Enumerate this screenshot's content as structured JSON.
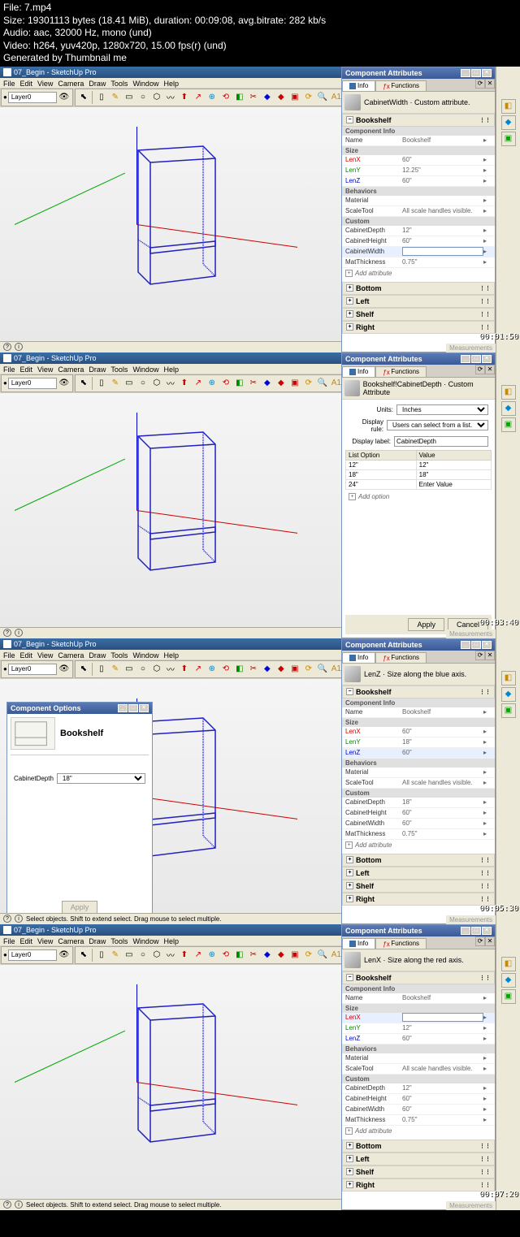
{
  "file_info": {
    "line1": "File: 7.mp4",
    "line2": "Size: 19301113 bytes (18.41 MiB), duration: 00:09:08, avg.bitrate: 282 kb/s",
    "line3": "Audio: aac, 32000 Hz, mono (und)",
    "line4": "Video: h264, yuv420p, 1280x720, 15.00 fps(r) (und)",
    "line5": "Generated by Thumbnail me"
  },
  "app_title": "07_Begin - SketchUp Pro",
  "menus": [
    "File",
    "Edit",
    "View",
    "Camera",
    "Draw",
    "Tools",
    "Window",
    "Help"
  ],
  "layer": "Layer0",
  "panel_title": "Component Attributes",
  "tabs": {
    "info": "Info",
    "functions": "Functions"
  },
  "frame1": {
    "header_text": "CabinetWidth · Custom attribute.",
    "bookshelf": "Bookshelf",
    "comp_info": "Component Info",
    "name_label": "Name",
    "name_val": "Bookshelf",
    "size": "Size",
    "lenx": "LenX",
    "lenx_val": "60\"",
    "leny": "LenY",
    "leny_val": "12.25\"",
    "lenz": "LenZ",
    "lenz_val": "60\"",
    "behaviors": "Behaviors",
    "material": "Material",
    "scaletool": "ScaleTool",
    "scaletool_val": "All scale handles visible.",
    "custom": "Custom",
    "cdepth": "CabinetDepth",
    "cdepth_val": "12\"",
    "cheight": "CabinetHeight",
    "cheight_val": "60\"",
    "cwidth": "CabinetWidth",
    "cwidth_val": "",
    "mthick": "MatThickness",
    "mthick_val": "0.75\"",
    "add_attr": "Add attribute",
    "bottom": "Bottom",
    "left": "Left",
    "shelf": "Shelf",
    "right": "Right",
    "timestamp": "00:01:50"
  },
  "frame2": {
    "header_text": "Bookshelf!CabinetDepth · Custom Attribute",
    "units_label": "Units:",
    "units_val": "Inches",
    "rule_label": "Display rule:",
    "rule_val": "Users can select from a list.",
    "dlabel_label": "Display label:",
    "dlabel_val": "CabinetDepth",
    "th_option": "List Option",
    "th_value": "Value",
    "opts": [
      {
        "o": "12\"",
        "v": "12\""
      },
      {
        "o": "18\"",
        "v": "18\""
      },
      {
        "o": "24\"",
        "v": "Enter Value"
      }
    ],
    "add_option": "Add option",
    "apply": "Apply",
    "cancel": "Cancel",
    "timestamp": "00:03:40"
  },
  "frame3": {
    "comp_opts_title": "Component Options",
    "comp_name": "Bookshelf",
    "cdepth_label": "CabinetDepth",
    "cdepth_sel": "18\"",
    "apply": "Apply",
    "header_text": "LenZ · Size along the blue axis.",
    "bookshelf": "Bookshelf",
    "comp_info": "Component Info",
    "name_label": "Name",
    "name_val": "Bookshelf",
    "size": "Size",
    "lenx": "LenX",
    "lenx_val": "60\"",
    "leny": "LenY",
    "leny_val": "18\"",
    "lenz": "LenZ",
    "lenz_val": "60\"",
    "behaviors": "Behaviors",
    "material": "Material",
    "scaletool": "ScaleTool",
    "scaletool_val": "All scale handles visible.",
    "custom": "Custom",
    "cdepth": "CabinetDepth",
    "cdepth_val": "18\"",
    "cheight": "CabinetHeight",
    "cheight_val": "60\"",
    "cwidth": "CabinetWidth",
    "cwidth_val": "60\"",
    "mthick": "MatThickness",
    "mthick_val": "0.75\"",
    "add_attr": "Add attribute",
    "bottom": "Bottom",
    "left": "Left",
    "shelf": "Shelf",
    "right": "Right",
    "status": "Select objects. Shift to extend select. Drag mouse to select multiple.",
    "timestamp": "00:05:30"
  },
  "frame4": {
    "header_text": "LenX · Size along the red axis.",
    "bookshelf": "Bookshelf",
    "comp_info": "Component Info",
    "name_label": "Name",
    "name_val": "Bookshelf",
    "size": "Size",
    "lenx": "LenX",
    "lenx_val": "",
    "leny": "LenY",
    "leny_val": "12\"",
    "lenz": "LenZ",
    "lenz_val": "60\"",
    "behaviors": "Behaviors",
    "material": "Material",
    "scaletool": "ScaleTool",
    "scaletool_val": "All scale handles visible.",
    "custom": "Custom",
    "cdepth": "CabinetDepth",
    "cdepth_val": "12\"",
    "cheight": "CabinetHeight",
    "cheight_val": "60\"",
    "cwidth": "CabinetWidth",
    "cwidth_val": "60\"",
    "mthick": "MatThickness",
    "mthick_val": "0.75\"",
    "add_attr": "Add attribute",
    "bottom": "Bottom",
    "left": "Left",
    "shelf": "Shelf",
    "right": "Right",
    "status": "Select objects. Shift to extend select. Drag mouse to select multiple.",
    "timestamp": "00:07:20"
  },
  "measurements": "Measurements"
}
